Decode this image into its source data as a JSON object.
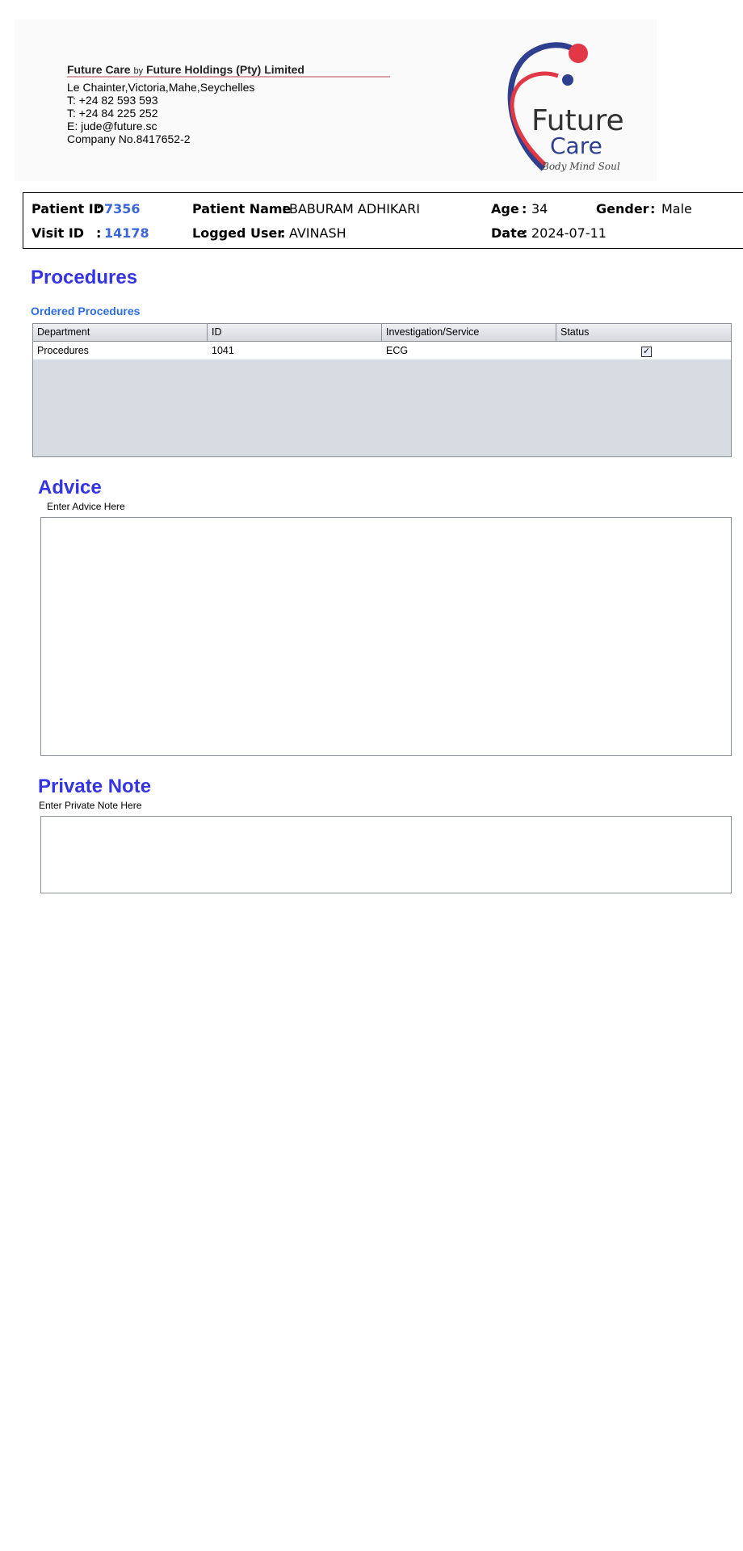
{
  "letterhead": {
    "company_name": "Future Care",
    "company_by": "by",
    "company_holding": "Future Holdings (Pty) Limited",
    "address_lines": [
      "Le Chainter,Victoria,Mahe,Seychelles",
      "T: +24  82 593 593",
      "T: +24  84 225 252",
      "E: jude@future.sc",
      "Company No.8417652-2"
    ],
    "logo": {
      "word1": "Future",
      "word2": "Care",
      "tagline": "Body Mind Soul",
      "colors": {
        "blue": "#2e3f8f",
        "red": "#e23744"
      }
    }
  },
  "patient": {
    "patient_id_label": "Patient ID",
    "patient_id_value": "7356",
    "visit_id_label": "Visit ID",
    "visit_id_value": "14178",
    "patient_name_label": "Patient Name",
    "patient_name_value": "BABURAM ADHIKARI",
    "logged_user_label": "Logged User",
    "logged_user_value": "AVINASH",
    "age_label": "Age",
    "age_value": "34",
    "gender_label": "Gender",
    "gender_value": "Male",
    "date_label": "Date",
    "date_value": "2024-07-11",
    "colon": ":"
  },
  "procedures": {
    "title": "Procedures",
    "subtitle": "Ordered Procedures",
    "columns": [
      "Department",
      "ID",
      "Investigation/Service",
      "Status"
    ],
    "rows": [
      {
        "department": "Procedures",
        "id": "1041",
        "service": "ECG",
        "status": "checked"
      }
    ]
  },
  "advice": {
    "title": "Advice",
    "helper": "Enter Advice Here",
    "value": ""
  },
  "private_note": {
    "title": "Private Note",
    "helper": "Enter Private Note Here",
    "value": ""
  },
  "colors": {
    "heading": "#3434e0",
    "subheading": "#2e6de0",
    "id_value": "#3a66d6"
  }
}
